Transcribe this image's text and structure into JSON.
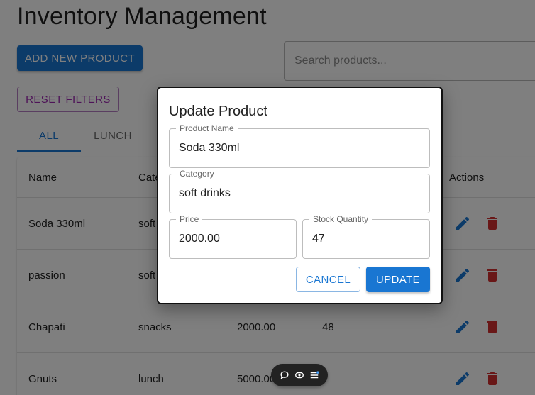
{
  "page": {
    "title": "Inventory Management"
  },
  "toolbar": {
    "add_label": "ADD NEW PRODUCT",
    "reset_label": "RESET FILTERS",
    "search_placeholder": "Search products..."
  },
  "tabs": [
    {
      "label": "ALL",
      "active": true
    },
    {
      "label": "LUNCH",
      "active": false
    }
  ],
  "table": {
    "headers": {
      "name": "Name",
      "category": "Cate",
      "actions": "Actions"
    },
    "rows": [
      {
        "name": "Soda 330ml",
        "category": "soft",
        "price": "",
        "stock": ""
      },
      {
        "name": "passion",
        "category": "soft",
        "price": "",
        "stock": ""
      },
      {
        "name": "Chapati",
        "category": "snacks",
        "price": "2000.00",
        "stock": "48"
      },
      {
        "name": "Gnuts",
        "category": "lunch",
        "price": "5000.00",
        "stock": ""
      }
    ]
  },
  "dialog": {
    "title": "Update Product",
    "fields": {
      "name": {
        "label": "Product Name",
        "value": "Soda 330ml"
      },
      "category": {
        "label": "Category",
        "value": "soft drinks"
      },
      "price": {
        "label": "Price",
        "value": "2000.00"
      },
      "stock": {
        "label": "Stock Quantity",
        "value": "47"
      }
    },
    "cancel_label": "CANCEL",
    "update_label": "UPDATE"
  },
  "colors": {
    "primary": "#1976d2",
    "secondary": "#9c27b0",
    "delete": "#d32f2f"
  },
  "icons": {
    "edit": "edit-icon",
    "delete": "delete-icon",
    "chat": "chat-icon",
    "eye": "eye-icon",
    "list": "list-icon"
  }
}
